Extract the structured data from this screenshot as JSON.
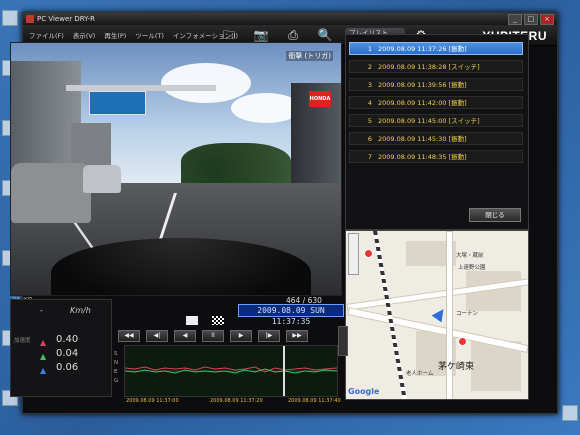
{
  "window": {
    "title": "PC Viewer DRY-R"
  },
  "brand": "YUPITERU",
  "menu": [
    "ファイル(F)",
    "表示(V)",
    "再生(P)",
    "ツール(T)",
    "インフォメーション(I)"
  ],
  "toolbar": [
    {
      "name": "open-folder-icon",
      "glyph": "🗀"
    },
    {
      "name": "camera-icon",
      "glyph": "📷"
    },
    {
      "name": "print-icon",
      "glyph": "⎙"
    },
    {
      "name": "zoom-icon",
      "glyph": "🔍"
    },
    {
      "name": "save-icon",
      "glyph": "💾"
    },
    {
      "name": "globe-icon",
      "glyph": "◕"
    },
    {
      "name": "settings-icon",
      "glyph": "⚙"
    }
  ],
  "video": {
    "overlay": "衝撃 (トリガ)",
    "size": "36 KB",
    "frame": "464 / 630"
  },
  "playlist": {
    "tab": "プレイリスト",
    "items": [
      {
        "n": "1",
        "text": "2009.08.09 11:37:26 [振動]",
        "selected": true
      },
      {
        "n": "2",
        "text": "2009.08.09 11:38:28 [スイッチ]",
        "selected": false
      },
      {
        "n": "3",
        "text": "2009.08.09 11:39:56 [振動]",
        "selected": false
      },
      {
        "n": "4",
        "text": "2009.08.09 11:42:00 [振動]",
        "selected": false
      },
      {
        "n": "5",
        "text": "2009.08.09 11:45:00 [スイッチ]",
        "selected": false
      },
      {
        "n": "6",
        "text": "2009.08.09 11:45:30 [振動]",
        "selected": false
      },
      {
        "n": "7",
        "text": "2009.08.09 11:48:35 [振動]",
        "selected": false
      }
    ],
    "close_label": "閉じる"
  },
  "dashboard": {
    "speed_value": "-",
    "speed_unit": "Km/h",
    "g_label": "加速度",
    "gx": "0.40",
    "gy": "0.04",
    "gz": "0.06"
  },
  "playback": {
    "datetime": "2009.08.09 SUN 11:37:35",
    "buttons": [
      "◀◀",
      "◀|",
      "◀",
      "II",
      "▶",
      "|▶",
      "▶▶"
    ]
  },
  "graph": {
    "axis_labels": [
      "S",
      "N",
      "E",
      "G"
    ],
    "timestamps": [
      "2009.08.09 11:37:00",
      "2009.08.09 11:37:20",
      "2009.08.09 11:37:40"
    ]
  },
  "map": {
    "labels": [
      "コーナン",
      "茅ケ崎東",
      "老人ホーム",
      "大塚・蔵前",
      "上遠野公園"
    ],
    "logo": "Google"
  },
  "colors": {
    "accent": "#2a6ec8",
    "playlist_text": "#f3d24a"
  }
}
